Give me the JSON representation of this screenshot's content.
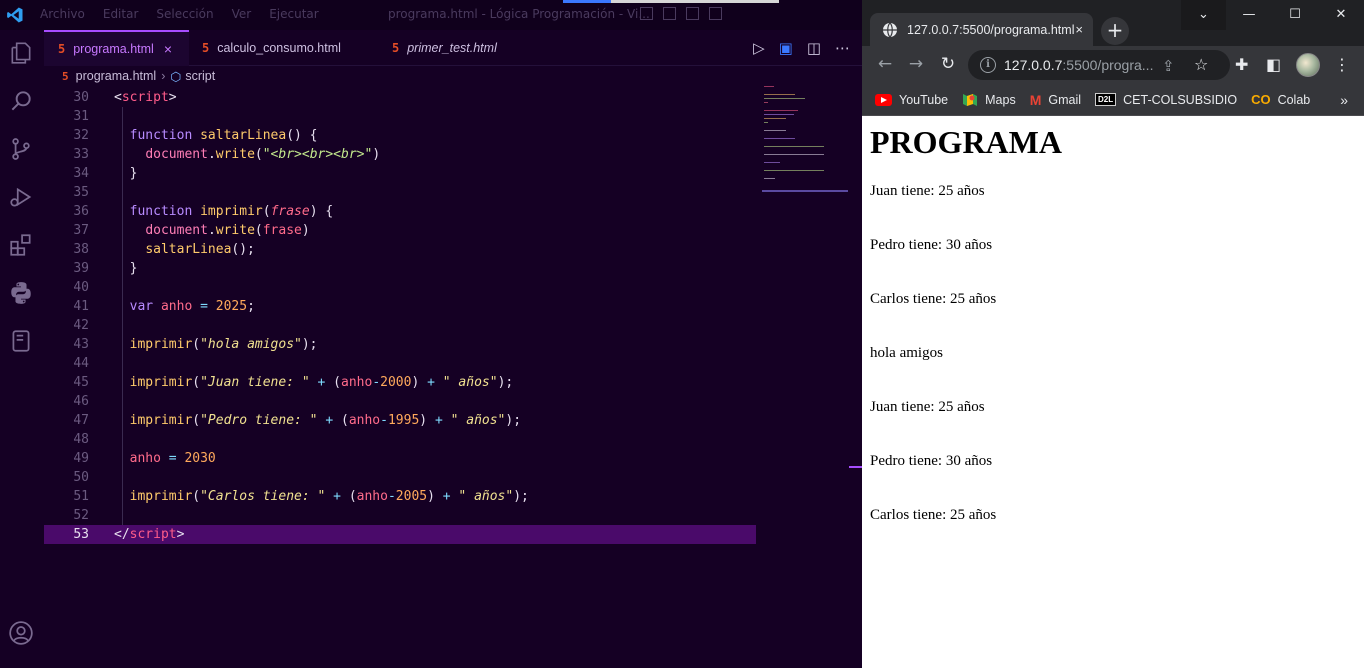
{
  "vscode": {
    "menu": [
      "Archivo",
      "Editar",
      "Selección",
      "Ver",
      "Ejecutar"
    ],
    "window_title": "programa.html - Lógica Programación - Vi...",
    "tabs": [
      {
        "label": "programa.html",
        "active": true,
        "close": "×"
      },
      {
        "label": "calculo_consumo.html",
        "active": false
      },
      {
        "label": "primer_test.html",
        "active": false,
        "italic": true
      }
    ],
    "breadcrumb": {
      "file": "programa.html",
      "symbol": "script"
    },
    "code_lines": [
      {
        "n": "30",
        "tokens": [
          [
            "br",
            "<"
          ],
          [
            "tag",
            "script"
          ],
          [
            "br",
            ">"
          ]
        ]
      },
      {
        "n": "31",
        "tokens": []
      },
      {
        "n": "32",
        "tokens": [
          [
            "br",
            "  "
          ],
          [
            "kw",
            "function"
          ],
          [
            "br",
            " "
          ],
          [
            "fn",
            "saltarLinea"
          ],
          [
            "br",
            "() {"
          ]
        ]
      },
      {
        "n": "33",
        "tokens": [
          [
            "br",
            "    "
          ],
          [
            "obj",
            "document"
          ],
          [
            "br",
            "."
          ],
          [
            "fn",
            "write"
          ],
          [
            "br",
            "("
          ],
          [
            "str",
            "\"<br><br><br>\""
          ],
          [
            "br",
            ")"
          ]
        ]
      },
      {
        "n": "34",
        "tokens": [
          [
            "br",
            "  }"
          ]
        ]
      },
      {
        "n": "35",
        "tokens": []
      },
      {
        "n": "36",
        "tokens": [
          [
            "br",
            "  "
          ],
          [
            "kw",
            "function"
          ],
          [
            "br",
            " "
          ],
          [
            "fn",
            "imprimir"
          ],
          [
            "br",
            "("
          ],
          [
            "param",
            "frase"
          ],
          [
            "br",
            ") {"
          ]
        ]
      },
      {
        "n": "37",
        "tokens": [
          [
            "br",
            "    "
          ],
          [
            "obj",
            "document"
          ],
          [
            "br",
            "."
          ],
          [
            "fn",
            "write"
          ],
          [
            "br",
            "("
          ],
          [
            "var",
            "frase"
          ],
          [
            "br",
            ")"
          ]
        ]
      },
      {
        "n": "38",
        "tokens": [
          [
            "br",
            "    "
          ],
          [
            "fn",
            "saltarLinea"
          ],
          [
            "br",
            "();"
          ]
        ]
      },
      {
        "n": "39",
        "tokens": [
          [
            "br",
            "  }"
          ]
        ]
      },
      {
        "n": "40",
        "tokens": []
      },
      {
        "n": "41",
        "tokens": [
          [
            "br",
            "  "
          ],
          [
            "kw",
            "var"
          ],
          [
            "br",
            " "
          ],
          [
            "var",
            "anho"
          ],
          [
            "br",
            " "
          ],
          [
            "op",
            "="
          ],
          [
            "br",
            " "
          ],
          [
            "num",
            "2025"
          ],
          [
            "br",
            ";"
          ]
        ]
      },
      {
        "n": "42",
        "tokens": []
      },
      {
        "n": "43",
        "tokens": [
          [
            "br",
            "  "
          ],
          [
            "fn",
            "imprimir"
          ],
          [
            "br",
            "("
          ],
          [
            "strq",
            "\"hola amigos\""
          ],
          [
            "br",
            ");"
          ]
        ]
      },
      {
        "n": "44",
        "tokens": []
      },
      {
        "n": "45",
        "tokens": [
          [
            "br",
            "  "
          ],
          [
            "fn",
            "imprimir"
          ],
          [
            "br",
            "("
          ],
          [
            "strq",
            "\"Juan tiene: \""
          ],
          [
            "br",
            " "
          ],
          [
            "op",
            "+"
          ],
          [
            "br",
            " ("
          ],
          [
            "var",
            "anho"
          ],
          [
            "op",
            "-"
          ],
          [
            "num",
            "2000"
          ],
          [
            "br",
            ") "
          ],
          [
            "op",
            "+"
          ],
          [
            "br",
            " "
          ],
          [
            "strq",
            "\" años\""
          ],
          [
            "br",
            ");"
          ]
        ]
      },
      {
        "n": "46",
        "tokens": []
      },
      {
        "n": "47",
        "tokens": [
          [
            "br",
            "  "
          ],
          [
            "fn",
            "imprimir"
          ],
          [
            "br",
            "("
          ],
          [
            "strq",
            "\"Pedro tiene: \""
          ],
          [
            "br",
            " "
          ],
          [
            "op",
            "+"
          ],
          [
            "br",
            " ("
          ],
          [
            "var",
            "anho"
          ],
          [
            "op",
            "-"
          ],
          [
            "num",
            "1995"
          ],
          [
            "br",
            ") "
          ],
          [
            "op",
            "+"
          ],
          [
            "br",
            " "
          ],
          [
            "strq",
            "\" años\""
          ],
          [
            "br",
            ");"
          ]
        ]
      },
      {
        "n": "48",
        "tokens": []
      },
      {
        "n": "49",
        "tokens": [
          [
            "br",
            "  "
          ],
          [
            "var",
            "anho"
          ],
          [
            "br",
            " "
          ],
          [
            "op",
            "="
          ],
          [
            "br",
            " "
          ],
          [
            "num",
            "2030"
          ]
        ]
      },
      {
        "n": "50",
        "tokens": []
      },
      {
        "n": "51",
        "tokens": [
          [
            "br",
            "  "
          ],
          [
            "fn",
            "imprimir"
          ],
          [
            "br",
            "("
          ],
          [
            "strq",
            "\"Carlos tiene: \""
          ],
          [
            "br",
            " "
          ],
          [
            "op",
            "+"
          ],
          [
            "br",
            " ("
          ],
          [
            "var",
            "anho"
          ],
          [
            "op",
            "-"
          ],
          [
            "num",
            "2005"
          ],
          [
            "br",
            ") "
          ],
          [
            "op",
            "+"
          ],
          [
            "br",
            " "
          ],
          [
            "strq",
            "\" años\""
          ],
          [
            "br",
            ");"
          ]
        ]
      },
      {
        "n": "52",
        "tokens": []
      },
      {
        "n": "53",
        "tokens": [
          [
            "br",
            "</"
          ],
          [
            "tag",
            "script"
          ],
          [
            "br",
            ">"
          ]
        ],
        "current": true
      }
    ]
  },
  "chrome": {
    "tab_title": "127.0.0.7:5500/programa.html",
    "tab_close": "×",
    "new_tab": "+",
    "url_host": "127.0.0.7",
    "url_path": ":5500/progra...",
    "bookmarks": [
      {
        "label": "YouTube",
        "icon": "youtube-icon"
      },
      {
        "label": "Maps",
        "icon": "maps-icon"
      },
      {
        "label": "Gmail",
        "icon": "gmail-icon"
      },
      {
        "label": "CET-COLSUBSIDIO",
        "icon": "d2l-icon"
      },
      {
        "label": "Colab",
        "icon": "colab-icon"
      }
    ],
    "bookmarks_more": "»"
  },
  "page": {
    "heading": "PROGRAMA",
    "lines": [
      "Juan tiene: 25 años",
      "Pedro tiene: 30 años",
      "Carlos tiene: 25 años",
      "hola amigos",
      "Juan tiene: 25 años",
      "Pedro tiene: 30 años",
      "Carlos tiene: 25 años"
    ]
  },
  "colors": {
    "vscode_bg": "#150024",
    "accent": "#a74dff",
    "chrome_dark": "#202124"
  }
}
